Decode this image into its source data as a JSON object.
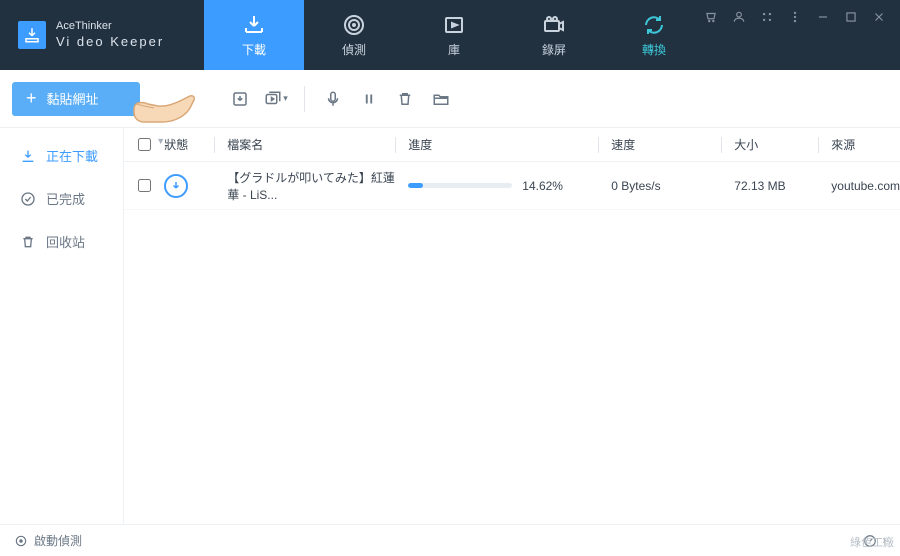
{
  "app": {
    "brand_line1": "AceThinker",
    "brand_line2": "Vi deo  Keeper"
  },
  "nav": {
    "download": "下載",
    "detect": "偵測",
    "library": "庫",
    "record": "錄屏",
    "convert": "轉換"
  },
  "toolbar": {
    "paste_url": "黏貼網址"
  },
  "sidebar": {
    "downloading": "正在下載",
    "completed": "已完成",
    "trash": "回收站"
  },
  "table": {
    "headers": {
      "status": "狀態",
      "filename": "檔案名",
      "progress": "進度",
      "speed": "速度",
      "size": "大小",
      "source": "來源"
    },
    "rows": [
      {
        "filename": "【グラドルが叩いてみた】紅蓮華 - LiS...",
        "progress_pct": 14.62,
        "progress_label": "14.62%",
        "speed": "0 Bytes/s",
        "size": "72.13 MB",
        "source": "youtube.com"
      }
    ]
  },
  "statusbar": {
    "auto_detect": "啟動偵測"
  },
  "watermark": "綠色工廠"
}
